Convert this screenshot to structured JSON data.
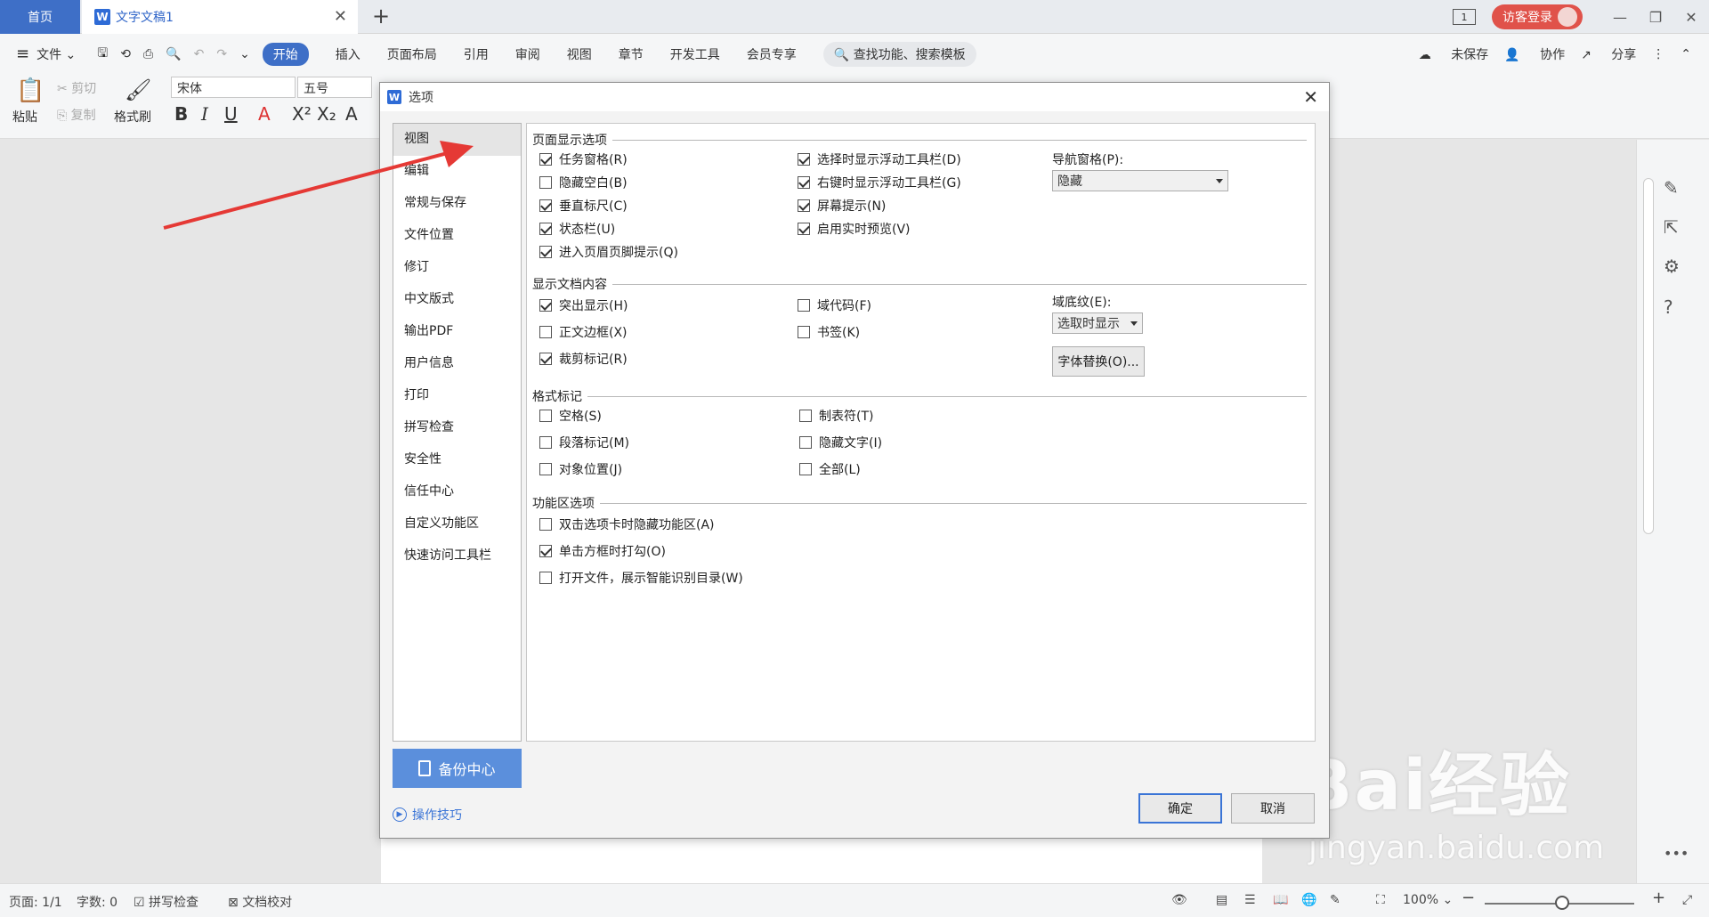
{
  "tabs": {
    "home": "首页",
    "doc_title": "文字文稿1",
    "page_badge": "1",
    "visitor_login": "访客登录"
  },
  "menu": {
    "file": "文件",
    "items": [
      "开始",
      "插入",
      "页面布局",
      "引用",
      "审阅",
      "视图",
      "章节",
      "开发工具",
      "会员专享"
    ],
    "search": "查找功能、搜索模板",
    "unsaved": "未保存",
    "collab": "协作",
    "share": "分享"
  },
  "toolbar": {
    "paste": "粘贴",
    "cut": "剪切",
    "copy": "复制",
    "format_painter": "格式刷",
    "font_name": "宋体",
    "font_size": "五号"
  },
  "dialog": {
    "title": "选项",
    "nav": [
      "视图",
      "编辑",
      "常规与保存",
      "文件位置",
      "修订",
      "中文版式",
      "输出PDF",
      "用户信息",
      "打印",
      "拼写检查",
      "安全性",
      "信任中心",
      "自定义功能区",
      "快速访问工具栏"
    ],
    "backup": "备份中心",
    "tips": "操作技巧",
    "ok": "确定",
    "cancel": "取消",
    "sections": {
      "page_display": "页面显示选项",
      "doc_content": "显示文档内容",
      "format_marks": "格式标记",
      "ribbon": "功能区选项"
    },
    "page_display": [
      {
        "label": "任务窗格(R)",
        "checked": true
      },
      {
        "label": "隐藏空白(B)",
        "checked": false
      },
      {
        "label": "垂直标尺(C)",
        "checked": true
      },
      {
        "label": "状态栏(U)",
        "checked": true
      },
      {
        "label": "进入页眉页脚提示(Q)",
        "checked": true
      },
      {
        "label": "选择时显示浮动工具栏(D)",
        "checked": true
      },
      {
        "label": "右键时显示浮动工具栏(G)",
        "checked": true
      },
      {
        "label": "屏幕提示(N)",
        "checked": true
      },
      {
        "label": "启用实时预览(V)",
        "checked": true
      }
    ],
    "nav_pane_label": "导航窗格(P):",
    "nav_pane_value": "隐藏",
    "doc_content": [
      {
        "label": "突出显示(H)",
        "checked": true
      },
      {
        "label": "正文边框(X)",
        "checked": false
      },
      {
        "label": "裁剪标记(R)",
        "checked": true
      },
      {
        "label": "域代码(F)",
        "checked": false
      },
      {
        "label": "书签(K)",
        "checked": false
      }
    ],
    "field_shading_label": "域底纹(E):",
    "field_shading_value": "选取时显示",
    "font_substitution": "字体替换(O)...",
    "format_marks": [
      {
        "label": "空格(S)",
        "checked": false
      },
      {
        "label": "段落标记(M)",
        "checked": false
      },
      {
        "label": "对象位置(J)",
        "checked": false
      },
      {
        "label": "制表符(T)",
        "checked": false
      },
      {
        "label": "隐藏文字(I)",
        "checked": false
      },
      {
        "label": "全部(L)",
        "checked": false
      }
    ],
    "ribbon": [
      {
        "label": "双击选项卡时隐藏功能区(A)",
        "checked": false
      },
      {
        "label": "单击方框时打勾(O)",
        "checked": true
      },
      {
        "label": "打开文件，展示智能识别目录(W)",
        "checked": false
      }
    ]
  },
  "status": {
    "page": "页面: 1/1",
    "words": "字数: 0",
    "spell": "拼写检查",
    "proof": "文档校对",
    "zoom": "100%"
  },
  "watermark": {
    "brand": "Bai经验",
    "url": "jingyan.baidu.com"
  },
  "colors": {
    "accent": "#3e6fc7",
    "visitor": "#e0524a",
    "arrow": "#e53935",
    "backup": "#5b8fdc"
  }
}
